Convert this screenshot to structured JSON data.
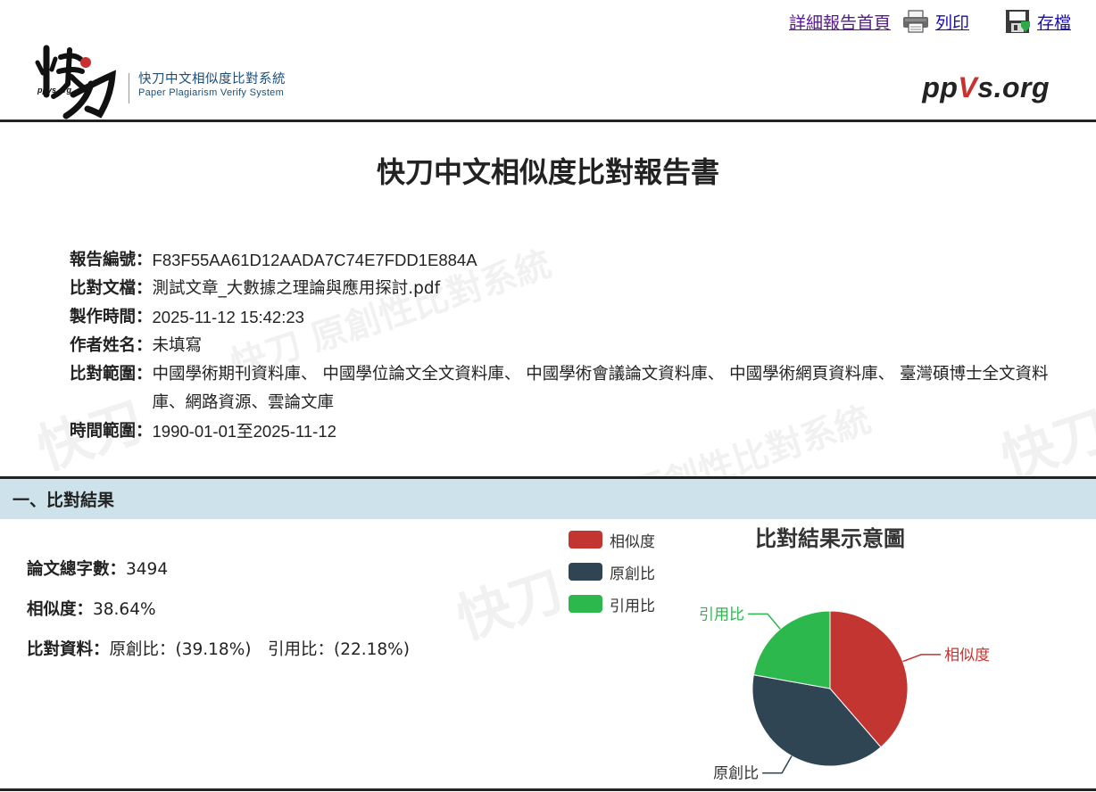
{
  "toplinks": {
    "home": "詳細報告首頁",
    "print": "列印",
    "save": "存檔"
  },
  "logo": {
    "zh": "快刀中文相似度比對系統",
    "en": "Paper Plagiarism Verify System",
    "brand_pre": "pp",
    "brand_v": "V",
    "brand_post": "s.org"
  },
  "title": "快刀中文相似度比對報告書",
  "info": {
    "report_id_label": "報告編號：",
    "report_id": "F83F55AA61D12AADA7C74E7FDD1E884A",
    "file_label": "比對文檔：",
    "file": "測試文章_大數據之理論與應用探討.pdf",
    "time_label": "製作時間：",
    "time": "2025-11-12 15:42:23",
    "author_label": "作者姓名：",
    "author": "未填寫",
    "scope_label": "比對範圍：",
    "scope": "中國學術期刊資料庫、 中國學位論文全文資料庫、 中國學術會議論文資料庫、 中國學術網頁資料庫、 臺灣碩博士全文資料庫、網路資源、雲論文庫",
    "range_label": "時間範圍：",
    "range": "1990-01-01至2025-11-12"
  },
  "section": {
    "title": "一、比對結果"
  },
  "stats": {
    "words_label": "論文總字數：",
    "words": "3494",
    "similarity_label": "相似度：",
    "similarity": "38.64%",
    "compare_label": "比對資料：",
    "compare": "原創比：(39.18%)　引用比：(22.18%)"
  },
  "chart_data": {
    "type": "pie",
    "title": "比對結果示意圖",
    "categories": [
      "相似度",
      "原創比",
      "引用比"
    ],
    "values": [
      38.64,
      39.18,
      22.18
    ],
    "colors": [
      "#c23531",
      "#2f4554",
      "#2db84d"
    ],
    "legend": "top-left"
  }
}
